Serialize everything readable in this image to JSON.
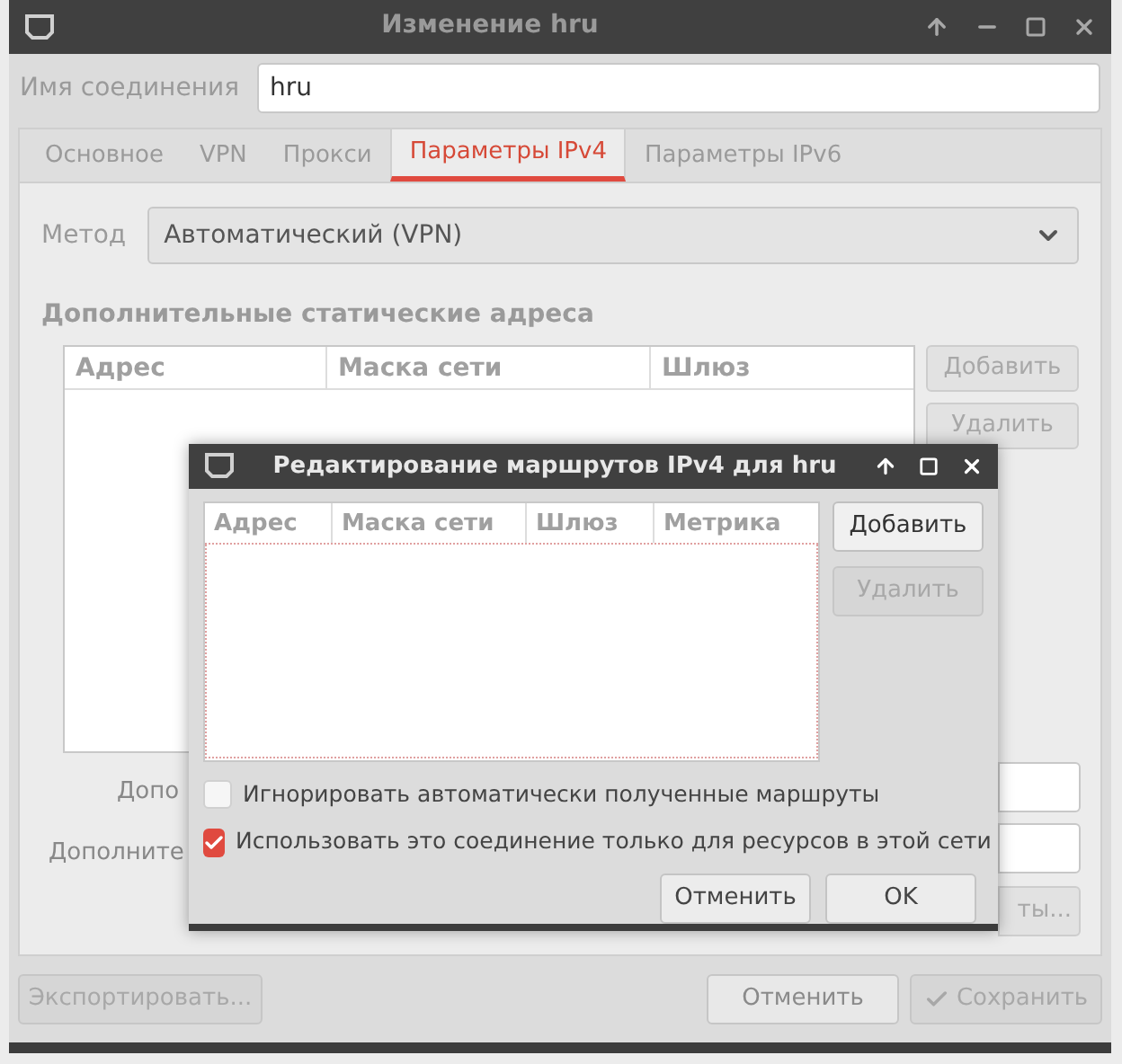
{
  "window": {
    "title": "Изменение hru"
  },
  "connection_name": {
    "label": "Имя соединения",
    "value": "hru"
  },
  "tabs": [
    {
      "label": "Основное",
      "selected": false
    },
    {
      "label": "VPN",
      "selected": false
    },
    {
      "label": "Прокси",
      "selected": false
    },
    {
      "label": "Параметры IPv4",
      "selected": true
    },
    {
      "label": "Параметры IPv6",
      "selected": false
    }
  ],
  "method": {
    "label": "Метод",
    "value": "Автоматический (VPN)"
  },
  "static_addresses": {
    "heading": "Дополнительные статические адреса",
    "columns": [
      "Адрес",
      "Маска сети",
      "Шлюз"
    ],
    "buttons": [
      {
        "label": "Добавить",
        "disabled": true
      },
      {
        "label": "Удалить",
        "disabled": true
      }
    ]
  },
  "partial_labels": [
    "Допо",
    "Дополните"
  ],
  "partial_button": "ты...",
  "bottom_buttons": [
    {
      "label": "Экспортировать...",
      "disabled": true,
      "kind": "plain"
    },
    {
      "label": "Отменить",
      "disabled": false,
      "kind": "plain"
    },
    {
      "label": "Сохранить",
      "disabled": true,
      "kind": "check"
    }
  ],
  "routes_dialog": {
    "title": "Редактирование маршрутов IPv4 для hru",
    "columns": [
      "Адрес",
      "Маска сети",
      "Шлюз",
      "Метрика"
    ],
    "buttons": [
      {
        "label": "Добавить",
        "disabled": false
      },
      {
        "label": "Удалить",
        "disabled": true
      }
    ],
    "checkboxes": [
      {
        "label": "Игнорировать автоматически полученные маршруты",
        "checked": false
      },
      {
        "label": "Использовать это соединение только для ресурсов в этой сети",
        "checked": true
      }
    ],
    "actions": [
      "Отменить",
      "OK"
    ]
  }
}
